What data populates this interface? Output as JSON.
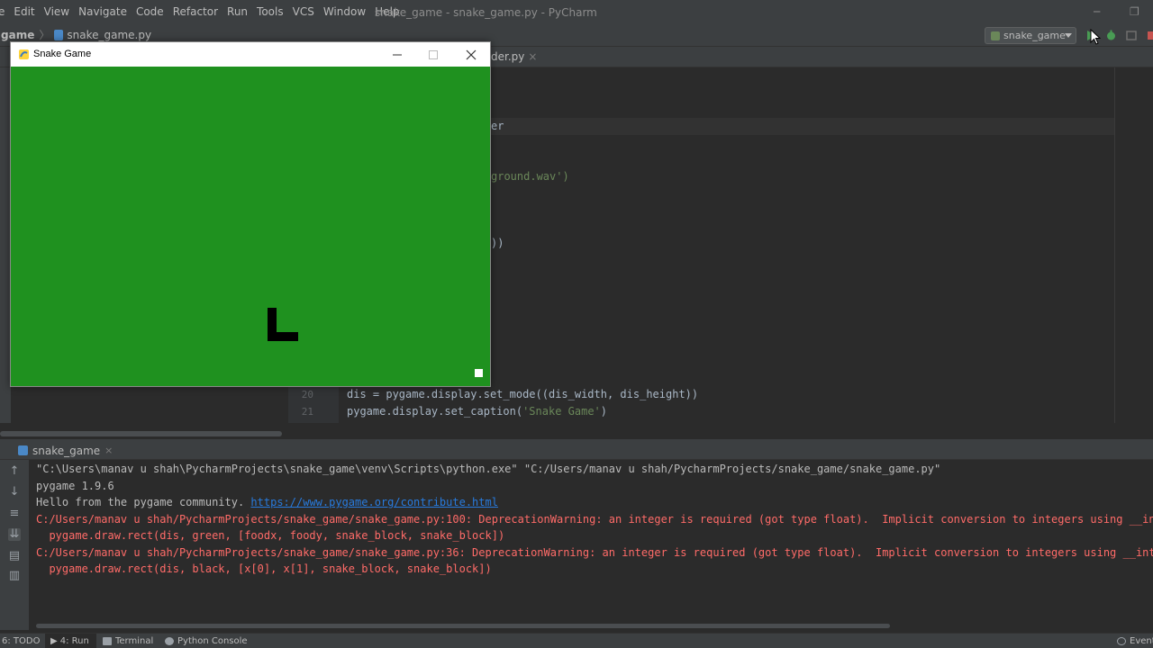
{
  "menubar": {
    "items": [
      "e",
      "Edit",
      "View",
      "Navigate",
      "Code",
      "Refactor",
      "Run",
      "Tools",
      "VCS",
      "Window",
      "Help"
    ],
    "window_title": "snake_game - snake_game.py - PyCharm"
  },
  "navbar": {
    "project": "game",
    "file": "snake_game.py"
  },
  "toolbar": {
    "run_config": "snake_game"
  },
  "editor": {
    "tab_fragment": "der.py",
    "fragments": {
      "er": "er",
      "wav": "ground.wav')",
      "paren": "))"
    },
    "lines": [
      {
        "num": "20",
        "code_a": "dis = pygame.display.set_mode((dis_width, dis_height))",
        "code_b": ""
      },
      {
        "num": "21",
        "code_a": "pygame.display.set_caption(",
        "code_b": "'Snake Game'",
        "code_c": ")"
      }
    ]
  },
  "game_window": {
    "title": "Snake Game",
    "bg_color": "#1f911f",
    "snake_color": "#000000",
    "food_color": "#ffffff"
  },
  "run_panel": {
    "tab_label": "snake_game",
    "console": [
      {
        "type": "cmd",
        "text": "\"C:\\Users\\manav u shah\\PycharmProjects\\snake_game\\venv\\Scripts\\python.exe\" \"C:/Users/manav u shah/PycharmProjects/snake_game/snake_game.py\""
      },
      {
        "type": "out",
        "text": "pygame 1.9.6"
      },
      {
        "type": "out",
        "text": "Hello from the pygame community. ",
        "link": "https://www.pygame.org/contribute.html"
      },
      {
        "type": "err",
        "text": "C:/Users/manav u shah/PycharmProjects/snake_game/snake_game.py:100: DeprecationWarning: an integer is required (got type float).  Implicit conversion to integers using __int__"
      },
      {
        "type": "err",
        "text": "  pygame.draw.rect(dis, green, [foodx, foody, snake_block, snake_block])"
      },
      {
        "type": "err",
        "text": "C:/Users/manav u shah/PycharmProjects/snake_game/snake_game.py:36: DeprecationWarning: an integer is required (got type float).  Implicit conversion to integers using __int__"
      },
      {
        "type": "err",
        "text": "  pygame.draw.rect(dis, black, [x[0], x[1], snake_block, snake_block])"
      }
    ]
  },
  "statusbar": {
    "todo": "6: TODO",
    "run": "4: Run",
    "terminal": "Terminal",
    "python_console": "Python Console",
    "event_log": "Event"
  }
}
